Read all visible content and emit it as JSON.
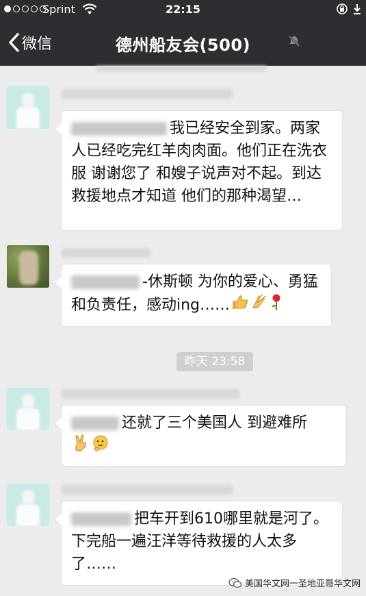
{
  "status": {
    "carrier": "Sprint",
    "time": "22:15"
  },
  "nav": {
    "back_label": "微信",
    "title": "德州船友会(500)"
  },
  "messages": [
    {
      "text": "我已经安全到家。两家人已经吃完红羊肉肉面。他们正在洗衣服 谢谢您了 和嫂子说声对不起。到达救援地点才知道 他们的那种渴望…"
    },
    {
      "text": "-休斯顿 为你的爱心、勇猛和负责任，感动ing……",
      "emojis": [
        "thumbs-up-icon",
        "clap-icon",
        "rose-icon"
      ]
    },
    {
      "text": "还就了三个美国人 到避难所",
      "emojis": [
        "victory-hand-icon",
        "thinking-face-icon"
      ]
    },
    {
      "text": "把车开到610哪里就是河了。下完船一遍汪洋等待救援的人太多了……"
    }
  ],
  "time_divider": "昨天 23:58",
  "watermark": "美国华文网一圣地亚哥华文网",
  "colors": {
    "bar": "#2e2e32",
    "chat_bg": "#ececec",
    "bubble": "#ffffff",
    "avatar": "#c9ebe6"
  }
}
